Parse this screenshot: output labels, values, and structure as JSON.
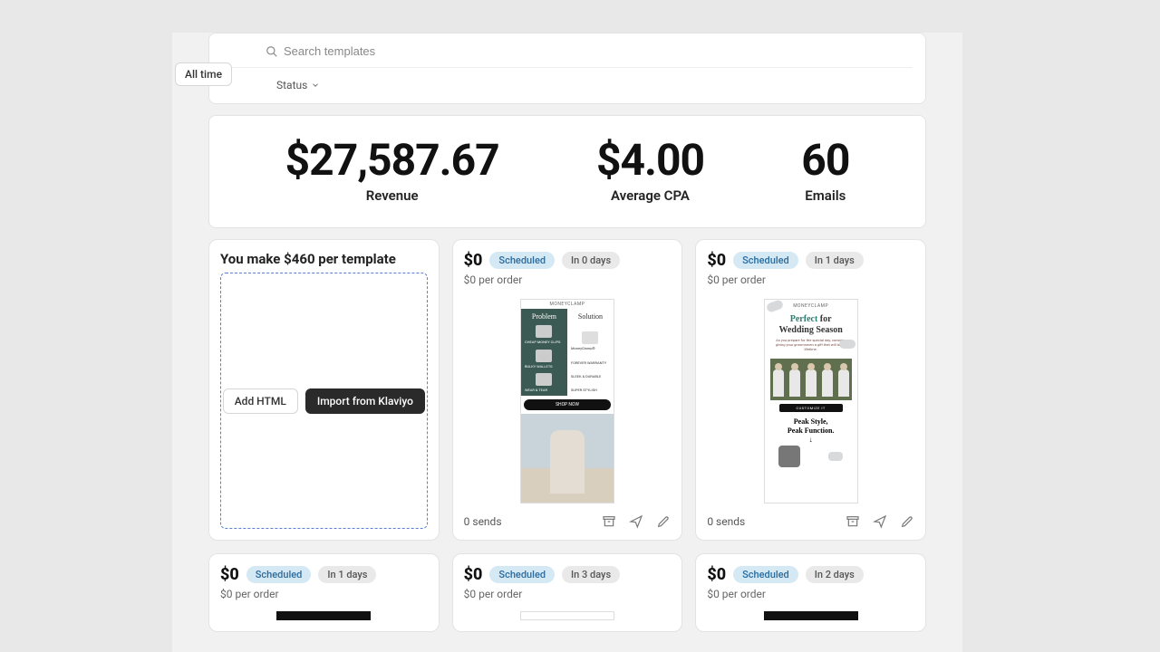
{
  "filters": {
    "all_time": "All time",
    "search_placeholder": "Search templates",
    "status_label": "Status"
  },
  "stats": {
    "revenue": {
      "value": "$27,587.67",
      "label": "Revenue"
    },
    "cpa": {
      "value": "$4.00",
      "label": "Average CPA"
    },
    "emails": {
      "value": "60",
      "label": "Emails"
    }
  },
  "create": {
    "title": "You make $460 per template",
    "add_html": "Add HTML",
    "import_klaviyo": "Import from Klaviyo"
  },
  "cards": [
    {
      "amount": "$0",
      "status": "Scheduled",
      "timing": "In 0 days",
      "per_order": "$0 per order",
      "sends": "0 sends",
      "thumb": {
        "brand": "MONEYCLAMP",
        "left_hdr": "Problem",
        "right_hdr": "Solution",
        "left_items": [
          "CHEAP MONEY CLIPS",
          "BULKY WALLETS",
          "WEAR & TEAR"
        ],
        "right_items": [
          "MoneyClamp®",
          "FOREVER WARRANTY",
          "SLEEK & DURABLE",
          "SUPER STYLISH"
        ],
        "cta": "SHOP NOW"
      }
    },
    {
      "amount": "$0",
      "status": "Scheduled",
      "timing": "In 1 days",
      "per_order": "$0 per order",
      "sends": "0 sends",
      "thumb": {
        "brand": "MONEYCLAMP",
        "title_teal": "Perfect",
        "title_rest": " for Wedding Season",
        "sub": "As you prepare for the special day, consider giving your groomsmen a gift that will last a lifetime.",
        "customize": "CUSTOMIZE IT",
        "peak1": "Peak Style,",
        "peak2": "Peak Function."
      }
    }
  ],
  "row2": [
    {
      "amount": "$0",
      "status": "Scheduled",
      "timing": "In 1 days",
      "per_order": "$0 per order"
    },
    {
      "amount": "$0",
      "status": "Scheduled",
      "timing": "In 3 days",
      "per_order": "$0 per order"
    },
    {
      "amount": "$0",
      "status": "Scheduled",
      "timing": "In 2 days",
      "per_order": "$0 per order"
    }
  ]
}
